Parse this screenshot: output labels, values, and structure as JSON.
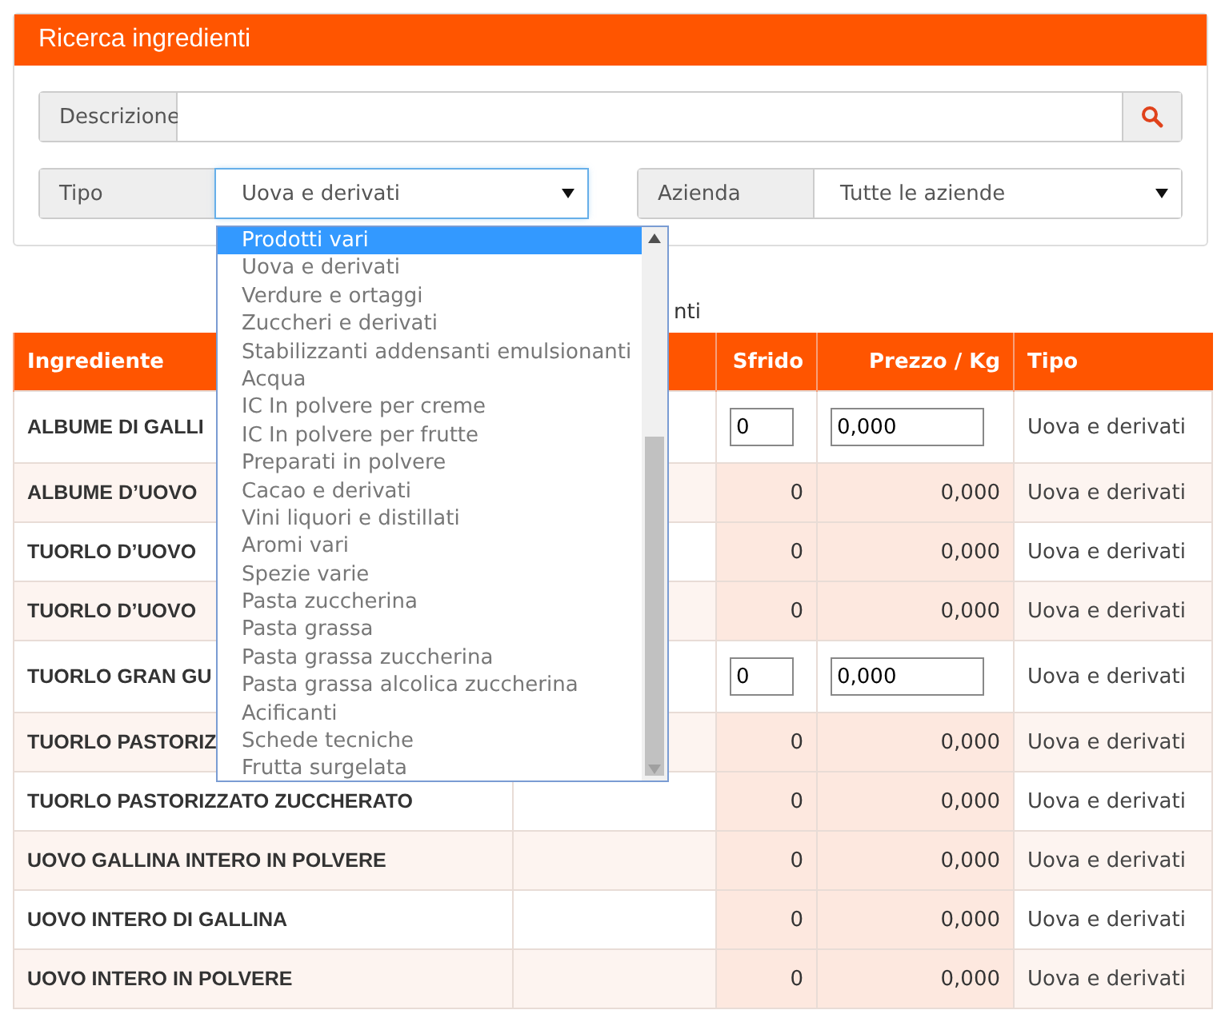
{
  "panel": {
    "title": "Ricerca ingredienti"
  },
  "search": {
    "label": "Descrizione"
  },
  "filters": [
    {
      "label": "Tipo",
      "value": "Uova e derivati",
      "focused": true
    },
    {
      "label": "Azienda",
      "value": "Tutte le aziende",
      "focused": false
    }
  ],
  "dropdown": {
    "options": [
      {
        "label": "Prodotti vari",
        "selected": true
      },
      {
        "label": "Uova e derivati",
        "selected": false
      },
      {
        "label": "Verdure e ortaggi",
        "selected": false
      },
      {
        "label": "Zuccheri e derivati",
        "selected": false
      },
      {
        "label": "Stabilizzanti addensanti emulsionanti",
        "selected": false
      },
      {
        "label": "Acqua",
        "selected": false
      },
      {
        "label": "IC In polvere per creme",
        "selected": false
      },
      {
        "label": "IC In polvere per frutte",
        "selected": false
      },
      {
        "label": "Preparati in polvere",
        "selected": false
      },
      {
        "label": "Cacao e derivati",
        "selected": false
      },
      {
        "label": "Vini liquori e distillati",
        "selected": false
      },
      {
        "label": "Aromi vari",
        "selected": false
      },
      {
        "label": "Spezie varie",
        "selected": false
      },
      {
        "label": "Pasta zuccherina",
        "selected": false
      },
      {
        "label": "Pasta grassa",
        "selected": false
      },
      {
        "label": "Pasta grassa zuccherina",
        "selected": false
      },
      {
        "label": "Pasta grassa alcolica zuccherina",
        "selected": false
      },
      {
        "label": "Acificanti",
        "selected": false
      },
      {
        "label": "Schede tecniche",
        "selected": false
      },
      {
        "label": "Frutta surgelata",
        "selected": false
      }
    ]
  },
  "result_note": "nti",
  "table": {
    "columns": [
      "Ingrediente",
      "",
      "Sfrido",
      "Prezzo / Kg",
      "Tipo"
    ],
    "rows": [
      {
        "kind": "editable",
        "ingrediente": "ALBUME DI GALLI",
        "sfrido": "0",
        "prezzo": "0,000",
        "tipo": "Uova e derivati"
      },
      {
        "kind": "readonly",
        "ingrediente": "ALBUME D’UOVO",
        "sfrido": "0",
        "prezzo": "0,000",
        "tipo": "Uova e derivati"
      },
      {
        "kind": "readonly",
        "ingrediente": "TUORLO D’UOVO",
        "sfrido": "0",
        "prezzo": "0,000",
        "tipo": "Uova e derivati"
      },
      {
        "kind": "readonly",
        "ingrediente": "TUORLO D’UOVO",
        "sfrido": "0",
        "prezzo": "0,000",
        "tipo": "Uova e derivati"
      },
      {
        "kind": "editable",
        "ingrediente": "TUORLO GRAN GU",
        "sfrido": "0",
        "prezzo": "0,000",
        "tipo": "Uova e derivati"
      },
      {
        "kind": "readonly",
        "ingrediente": "TUORLO PASTORIZ",
        "sfrido": "0",
        "prezzo": "0,000",
        "tipo": "Uova e derivati"
      },
      {
        "kind": "readonly",
        "ingrediente": "TUORLO PASTORIZZATO ZUCCHERATO",
        "sfrido": "0",
        "prezzo": "0,000",
        "tipo": "Uova e derivati"
      },
      {
        "kind": "readonly",
        "ingrediente": "UOVO GALLINA INTERO IN POLVERE",
        "sfrido": "0",
        "prezzo": "0,000",
        "tipo": "Uova e derivati"
      },
      {
        "kind": "readonly",
        "ingrediente": "UOVO INTERO DI GALLINA",
        "sfrido": "0",
        "prezzo": "0,000",
        "tipo": "Uova e derivati"
      },
      {
        "kind": "readonly",
        "ingrediente": "UOVO INTERO IN POLVERE",
        "sfrido": "0",
        "prezzo": "0,000",
        "tipo": "Uova e derivati"
      }
    ]
  }
}
